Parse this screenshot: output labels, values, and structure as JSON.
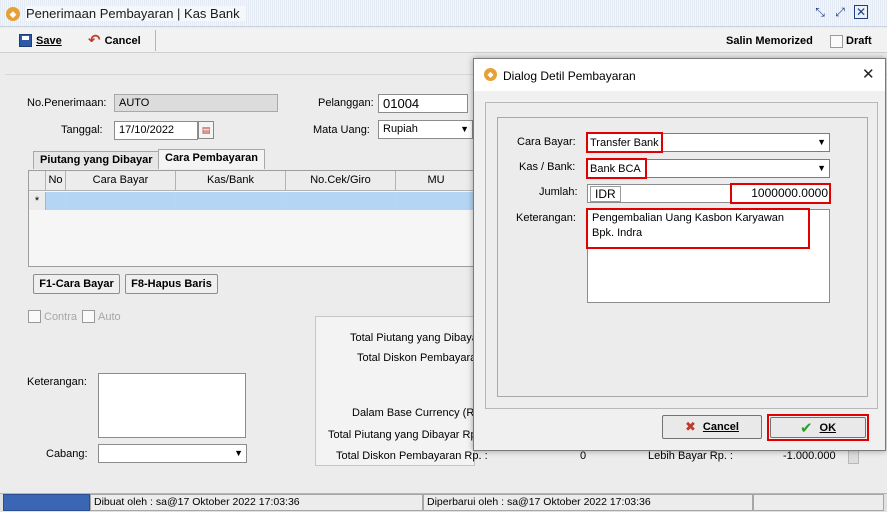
{
  "window": {
    "title": "Penerimaan Pembayaran | Kas Bank"
  },
  "toolbar": {
    "save_label": "Save",
    "cancel_label": "Cancel",
    "memorize_label": "Salin Memorized",
    "draft_label": "Draft"
  },
  "form": {
    "no_label": "No.Penerimaan:",
    "no_value": "AUTO",
    "date_label": "Tanggal:",
    "date_value": "17/10/2022",
    "customer_label": "Pelanggan:",
    "customer_value": "01004",
    "currency_label": "Mata Uang:",
    "currency_value": "Rupiah"
  },
  "tabs": [
    "Piutang yang Dibayar",
    "Cara Pembayaran"
  ],
  "grid": {
    "columns": [
      "No",
      "Cara Bayar",
      "Kas/Bank",
      "No.Cek/Giro",
      "MU"
    ],
    "row_marker": "*"
  },
  "grid_buttons": {
    "add": "F1-Cara Bayar",
    "delete": "F8-Hapus Baris"
  },
  "options": {
    "contra": "Contra",
    "auto": "Auto"
  },
  "notes": {
    "keterangan_label": "Keterangan:",
    "cabang_label": "Cabang:"
  },
  "summary": {
    "total_piutang": "Total Piutang yang Dibaya",
    "total_diskon": "Total Diskon Pembayara",
    "base_currency": "Dalam Base Currency (R",
    "total_piutang_rp": "Total Piutang yang Dibayar Rp",
    "total_diskon_rp": "Total Diskon Pembayaran Rp. :",
    "total_diskon_rp_value": "0",
    "lebih_bayar_label": "Lebih Bayar Rp. :",
    "lebih_bayar_value": "-1.000.000"
  },
  "status": {
    "created": "Dibuat oleh : sa@17 Oktober 2022  17:03:36",
    "updated": "Diperbarui oleh : sa@17 Oktober 2022  17:03:36"
  },
  "dialog": {
    "title": "Dialog Detil Pembayaran",
    "cara_bayar_label": "Cara Bayar:",
    "cara_bayar_value": "Transfer Bank",
    "kas_bank_label": "Kas / Bank:",
    "kas_bank_value": "Bank BCA",
    "jumlah_label": "Jumlah:",
    "currency": "IDR",
    "amount": "1000000.0000",
    "keterangan_label": "Keterangan:",
    "keterangan_value": "Pengembalian Uang Kasbon Karyawan Bpk. Indra",
    "cancel_label": "Cancel",
    "ok_label": "OK"
  },
  "colors": {
    "highlight": "#e00000",
    "selected_row": "#b5d5f5",
    "status_accent": "#3a66b3"
  },
  "icons": [
    "app-icon",
    "save-icon",
    "undo-icon",
    "calendar-icon",
    "check-icon",
    "x-icon",
    "close-icon"
  ]
}
